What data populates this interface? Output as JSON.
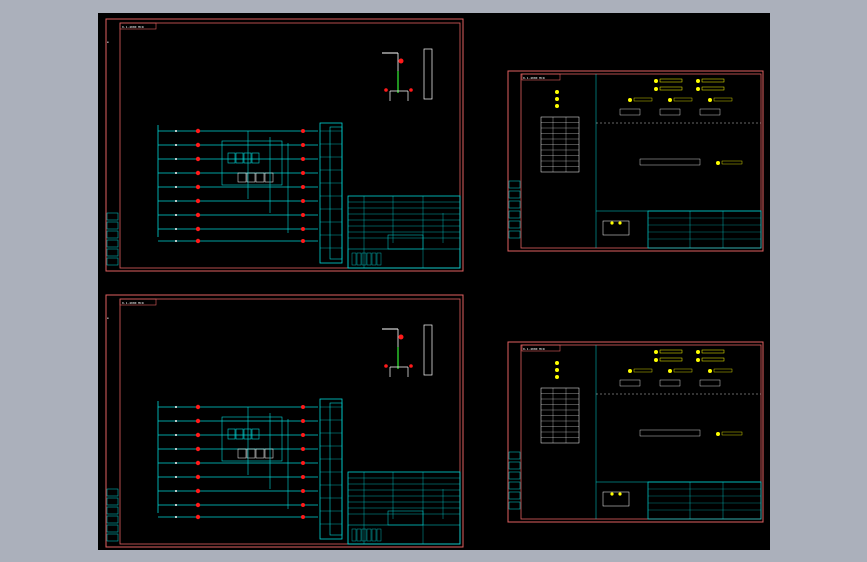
{
  "viewport": {
    "background": "#abb0bb",
    "canvas_color": "#000000",
    "border_color": "#e06060",
    "wire_color": "#00d7d7",
    "terminal_color": "#ff1a1a",
    "text_color": "#ffffff",
    "highlight_color": "#ffff00",
    "ground_color": "#30e030"
  },
  "sheets": [
    {
      "title_tag": "0-1-4000 MCR"
    },
    {
      "title_tag": "0-1-4000 MCR"
    },
    {
      "title_tag": "0-1-4000 MCR"
    },
    {
      "title_tag": "0-1-4000 MCR"
    }
  ]
}
